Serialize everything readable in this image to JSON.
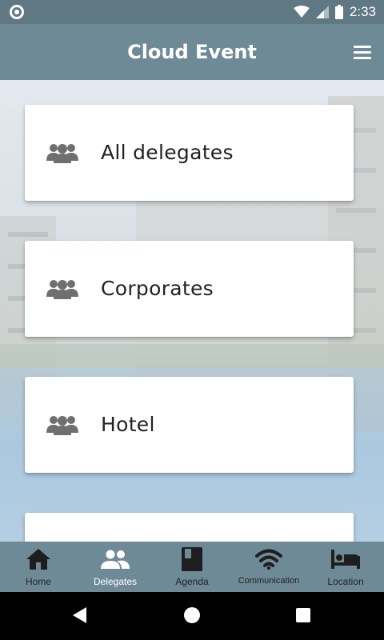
{
  "status_bar": {
    "time": "2:33"
  },
  "app_bar": {
    "title": "Cloud Event"
  },
  "cards": [
    {
      "label": "All delegates"
    },
    {
      "label": "Corporates"
    },
    {
      "label": "Hotel"
    }
  ],
  "bottom_nav": {
    "items": [
      {
        "label": "Home",
        "icon": "home-icon"
      },
      {
        "label": "Delegates",
        "icon": "people-icon",
        "active": true
      },
      {
        "label": "Agenda",
        "icon": "book-icon"
      },
      {
        "label": "Communication",
        "icon": "wifi-icon"
      },
      {
        "label": "Location",
        "icon": "bed-icon"
      }
    ]
  },
  "colors": {
    "app_bar": "#6e8a97",
    "status_bar": "#5f7884",
    "active_nav_label": "#ffffff"
  }
}
